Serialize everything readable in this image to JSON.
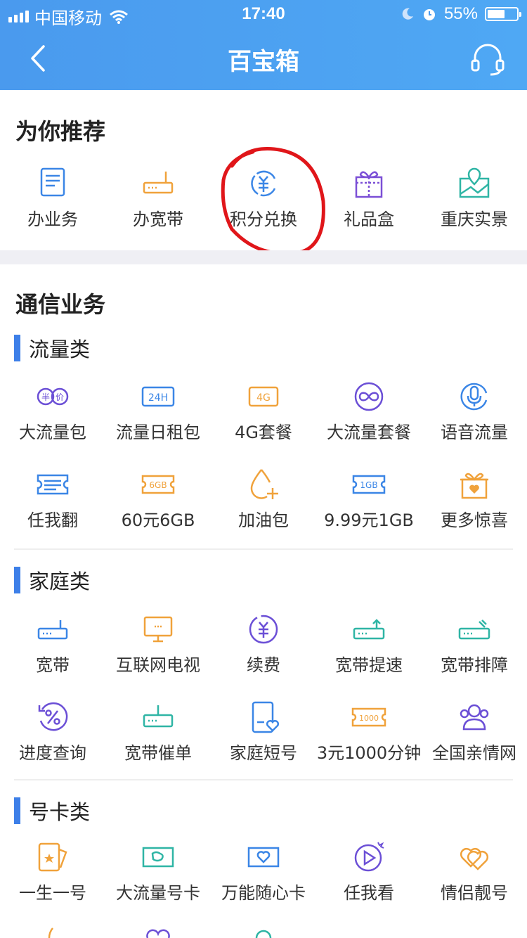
{
  "status": {
    "carrier": "中国移动",
    "time": "17:40",
    "battery": "55%"
  },
  "nav": {
    "title": "百宝箱"
  },
  "recommend": {
    "title": "为你推荐",
    "items": [
      {
        "label": "办业务",
        "icon": "document-icon"
      },
      {
        "label": "办宽带",
        "icon": "router-icon"
      },
      {
        "label": "积分兑换",
        "icon": "points-exchange-icon"
      },
      {
        "label": "礼品盒",
        "icon": "gift-box-icon"
      },
      {
        "label": "重庆实景",
        "icon": "map-location-icon"
      }
    ]
  },
  "telecom": {
    "title": "通信业务",
    "data_category": {
      "title": "流量类",
      "items": [
        {
          "label": "大流量包",
          "icon": "half-price-icon"
        },
        {
          "label": "流量日租包",
          "icon": "24h-icon",
          "icon_text": "24H"
        },
        {
          "label": "4G套餐",
          "icon": "4g-icon",
          "icon_text": "4G"
        },
        {
          "label": "大流量套餐",
          "icon": "infinity-icon"
        },
        {
          "label": "语音流量",
          "icon": "microphone-icon"
        },
        {
          "label": "任我翻",
          "icon": "ticket-icon"
        },
        {
          "label": "60元6GB",
          "icon": "6gb-ticket-icon",
          "icon_text": "6GB"
        },
        {
          "label": "加油包",
          "icon": "drop-plus-icon"
        },
        {
          "label": "9.99元1GB",
          "icon": "1gb-ticket-icon",
          "icon_text": "1GB"
        },
        {
          "label": "更多惊喜",
          "icon": "surprise-gift-icon"
        }
      ]
    },
    "family_category": {
      "title": "家庭类",
      "items": [
        {
          "label": "宽带",
          "icon": "broadband-icon"
        },
        {
          "label": "互联网电视",
          "icon": "tv-icon"
        },
        {
          "label": "续费",
          "icon": "renew-icon"
        },
        {
          "label": "宽带提速",
          "icon": "broadband-speedup-icon"
        },
        {
          "label": "宽带排障",
          "icon": "broadband-repair-icon"
        },
        {
          "label": "进度查询",
          "icon": "progress-query-icon"
        },
        {
          "label": "宽带催单",
          "icon": "broadband-urge-icon"
        },
        {
          "label": "家庭短号",
          "icon": "family-shortnum-icon"
        },
        {
          "label": "3元1000分钟",
          "icon": "1000-minutes-icon",
          "icon_text": "1000"
        },
        {
          "label": "全国亲情网",
          "icon": "family-network-icon"
        }
      ]
    },
    "card_category": {
      "title": "号卡类",
      "items": [
        {
          "label": "一生一号",
          "icon": "star-card-icon"
        },
        {
          "label": "大流量号卡",
          "icon": "sim-map-icon"
        },
        {
          "label": "万能随心卡",
          "icon": "sim-heart-icon"
        },
        {
          "label": "任我看",
          "icon": "play-icon"
        },
        {
          "label": "情侣靓号",
          "icon": "couple-hearts-icon"
        }
      ]
    }
  },
  "colors": {
    "header": "#4a9aee",
    "accent_bar": "#3d7fe8",
    "annotation": "#e0161a"
  }
}
